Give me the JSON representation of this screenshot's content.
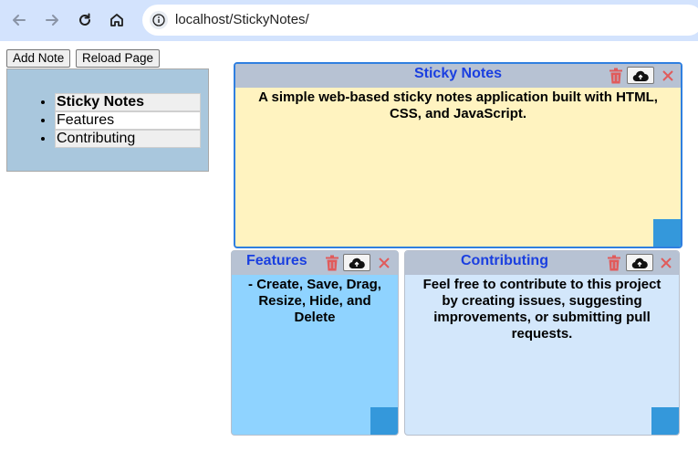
{
  "browser": {
    "url": "localhost/StickyNotes/",
    "icons": [
      "back-arrow-icon",
      "forward-arrow-icon",
      "reload-icon",
      "home-icon",
      "info-icon"
    ]
  },
  "toolbar": {
    "add_note_label": "Add Note",
    "reload_page_label": "Reload Page"
  },
  "menu": {
    "items": [
      {
        "label": "Sticky Notes",
        "selected": true
      },
      {
        "label": "Features",
        "selected": false
      },
      {
        "label": "Contributing",
        "selected": false
      }
    ]
  },
  "notes": [
    {
      "title": "Sticky Notes",
      "body": "A simple web-based sticky notes application built with HTML, CSS, and JavaScript.",
      "color": "#fff3c0"
    },
    {
      "title": "Features",
      "body": "- Create, Save, Drag, Resize, Hide, and Delete",
      "color": "#8fd3ff"
    },
    {
      "title": "Contributing",
      "body": "Feel free to contribute to this project by creating issues, suggesting improvements, or submitting pull requests.",
      "color": "#d3e7fb"
    }
  ],
  "colors": {
    "header": "#b7c2d3",
    "title_text": "#1a3fe0",
    "trash_icon": "#e15b5b",
    "close_icon": "#e15b5b",
    "resize_handle": "#3498db",
    "active_border": "#2f7fe0"
  }
}
